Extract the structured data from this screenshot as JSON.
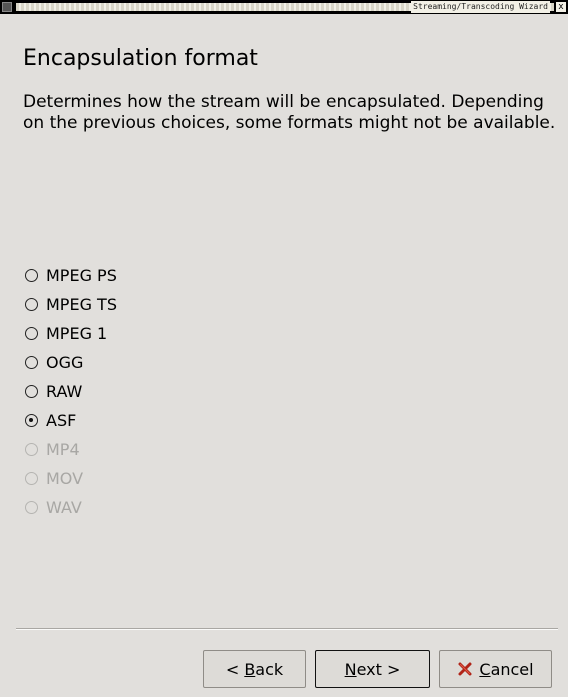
{
  "window": {
    "title": "Streaming/Transcoding Wizard",
    "close_glyph": "x"
  },
  "page": {
    "heading": "Encapsulation format",
    "description": "Determines how the stream will be encapsulated. Depending on the previous choices, some formats might not be available."
  },
  "formats": [
    {
      "label": "MPEG PS",
      "selected": false,
      "enabled": true
    },
    {
      "label": "MPEG TS",
      "selected": false,
      "enabled": true
    },
    {
      "label": "MPEG 1",
      "selected": false,
      "enabled": true
    },
    {
      "label": "OGG",
      "selected": false,
      "enabled": true
    },
    {
      "label": "RAW",
      "selected": false,
      "enabled": true
    },
    {
      "label": "ASF",
      "selected": true,
      "enabled": true
    },
    {
      "label": "MP4",
      "selected": false,
      "enabled": false
    },
    {
      "label": "MOV",
      "selected": false,
      "enabled": false
    },
    {
      "label": "WAV",
      "selected": false,
      "enabled": false
    }
  ],
  "buttons": {
    "back": {
      "prefix": "< ",
      "mnemonic": "B",
      "rest": "ack",
      "suffix": ""
    },
    "next": {
      "prefix": "",
      "mnemonic": "N",
      "rest": "ext",
      "suffix": " >"
    },
    "cancel": {
      "prefix": "",
      "mnemonic": "C",
      "rest": "ancel",
      "suffix": "",
      "icon": "cancel-x-icon",
      "icon_color": "#b02418"
    }
  },
  "colors": {
    "background": "#e1dfdc",
    "disabled_text": "#a8a7a4"
  }
}
